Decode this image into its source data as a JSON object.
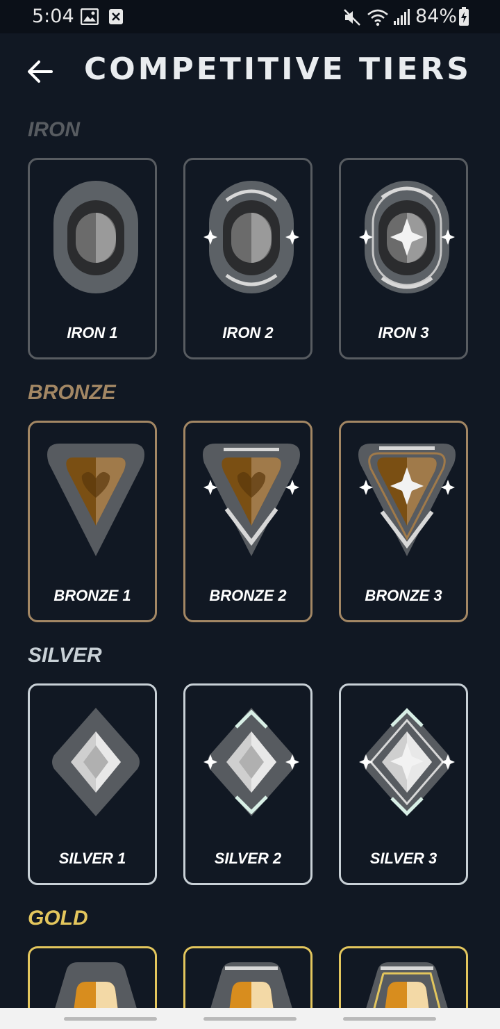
{
  "status_bar": {
    "time": "5:04",
    "battery": "84%",
    "icons": [
      "image-icon",
      "close-box-icon",
      "mute-icon",
      "wifi-icon",
      "signal-icon",
      "battery-charging-icon"
    ]
  },
  "header": {
    "title": "COMPETITIVE TIERS",
    "back_icon": "arrow-left-icon"
  },
  "colors": {
    "background": "#111823",
    "iron": "#585c61",
    "bronze": "#a38764",
    "silver": "#c8d0d6",
    "gold": "#e3c65d"
  },
  "sections": [
    {
      "name": "IRON",
      "color": "#585c61",
      "tiers": [
        "IRON 1",
        "IRON 2",
        "IRON 3"
      ]
    },
    {
      "name": "BRONZE",
      "color": "#a38764",
      "tiers": [
        "BRONZE 1",
        "BRONZE 2",
        "BRONZE 3"
      ]
    },
    {
      "name": "SILVER",
      "color": "#c8d0d6",
      "tiers": [
        "SILVER 1",
        "SILVER 2",
        "SILVER 3"
      ]
    },
    {
      "name": "GOLD",
      "color": "#e3c65d",
      "tiers": [
        "",
        "",
        ""
      ]
    }
  ]
}
